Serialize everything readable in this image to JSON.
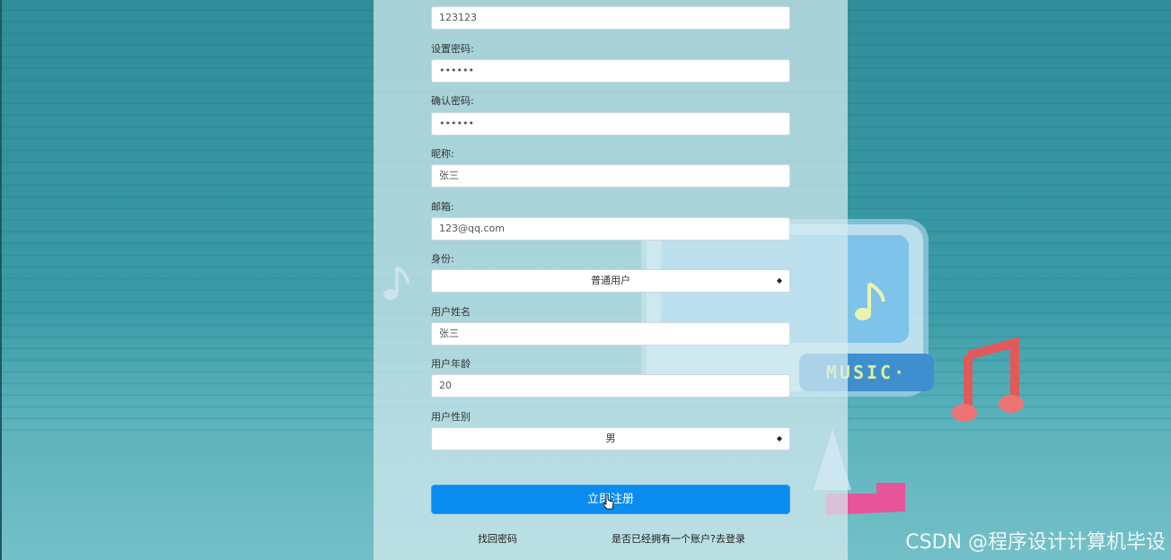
{
  "form": {
    "fields": [
      {
        "label": "",
        "value": "123123"
      },
      {
        "label": "设置密码:",
        "value": "••••••"
      },
      {
        "label": "确认密码:",
        "value": "••••••"
      },
      {
        "label": "昵称:",
        "value": "张三"
      },
      {
        "label": "邮箱:",
        "value": "123@qq.com"
      }
    ],
    "role_label": "身份:",
    "role_selected": "普通用户",
    "name_label": "用户姓名",
    "name_value": "张三",
    "age_label": "用户年龄",
    "age_value": "20",
    "gender_label": "用户性别",
    "gender_selected": "男",
    "register_button": "立即注册",
    "forgot_password_link": "找回密码",
    "login_link": "是否已经拥有一个账户?去登录"
  },
  "background": {
    "music_sign": "MUSIC·"
  },
  "watermark": "CSDN @程序设计计算机毕设",
  "colors": {
    "primary_button": "#0a8cf0",
    "background_teal": "#3a9ca6"
  }
}
